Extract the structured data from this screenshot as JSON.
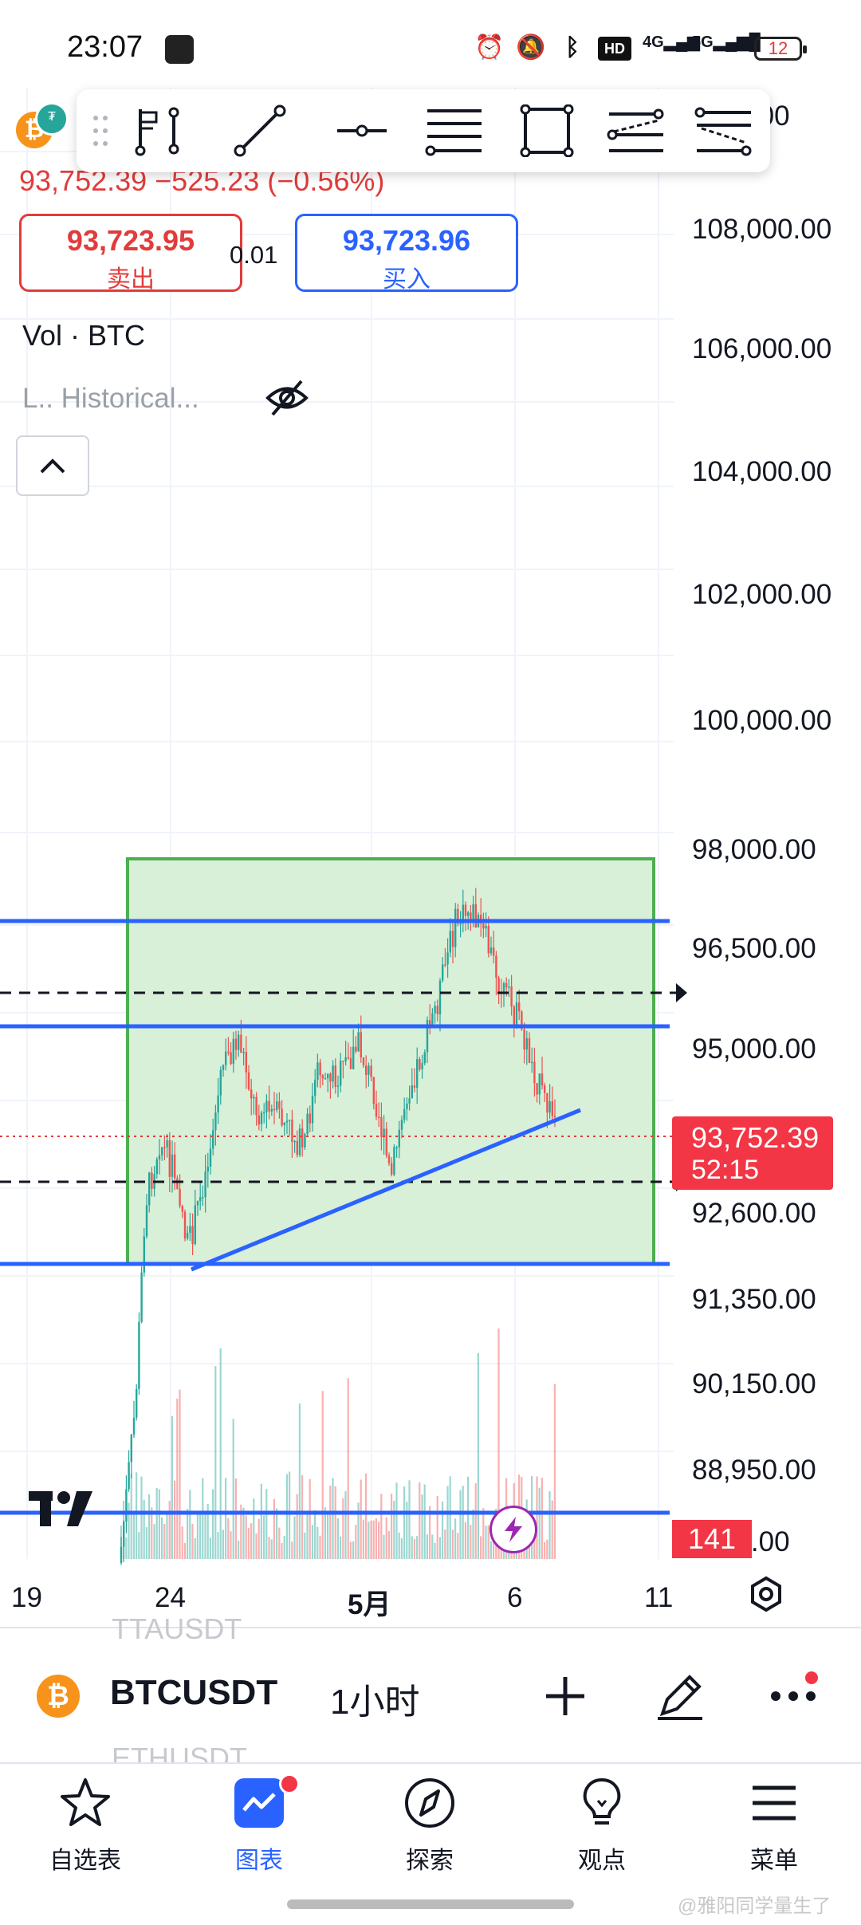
{
  "status_bar": {
    "time": "23:07",
    "icons": [
      "app-notification-icon",
      "alarm-icon",
      "mute-icon",
      "bluetooth-icon",
      "hd-icon",
      "4g-signal-icon",
      "5g-signal-icon",
      "battery-icon"
    ],
    "hd_label": "HD",
    "net1": "4G",
    "net2": "5G",
    "battery_level": "12"
  },
  "header": {
    "last_price_change": "93,752.39  −525.23 (−0.56%)",
    "sell_price": "93,723.95",
    "sell_label": "卖出",
    "spread": "0.01",
    "buy_price": "93,723.96",
    "buy_label": "买入",
    "volume_indicator": "Vol · BTC",
    "historical_indicator": "L.. Historical..."
  },
  "price_axis": {
    "labels": [
      "…00.00",
      "108,000.00",
      "106,000.00",
      "104,000.00",
      "102,000.00",
      "100,000.00",
      "98,000.00",
      "96,500.00",
      "95,000.00",
      "92,600.00",
      "91,350.00",
      "90,150.00",
      "88,950.00",
      "…50.00"
    ]
  },
  "time_axis": {
    "labels": [
      "19",
      "24",
      "5月",
      "6",
      "11"
    ]
  },
  "current_price": {
    "value": "93,752.39",
    "countdown": "52:15"
  },
  "volume_tag": "141",
  "colors": {
    "up": "#26a69a",
    "down": "#ef5350",
    "accent": "#2962ff",
    "box_fill": "#d8efd8",
    "box_border": "#4caf50",
    "price_tag": "#f23645"
  },
  "symbol_bar": {
    "ghost_above": "TTAUSDT",
    "symbol": "BTCUSDT",
    "interval": "1小时",
    "ghost_below": "ETHUSDT"
  },
  "bottom_nav": {
    "items": [
      {
        "label": "自选表",
        "icon": "star-icon"
      },
      {
        "label": "图表",
        "icon": "chart-icon"
      },
      {
        "label": "探索",
        "icon": "compass-icon"
      },
      {
        "label": "观点",
        "icon": "lightbulb-icon"
      },
      {
        "label": "菜单",
        "icon": "menu-icon"
      }
    ]
  },
  "watermark": "@雅阳同学量生了"
}
